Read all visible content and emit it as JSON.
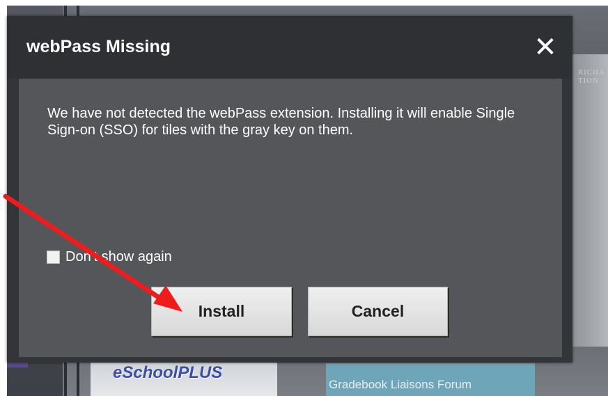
{
  "background": {
    "tiles": [
      {
        "label": "eSchoolPLUS"
      },
      {
        "label": "Gradebook Liaisons Forum"
      }
    ],
    "building_text": [
      "RICHA",
      "TION"
    ]
  },
  "dialog": {
    "title": "webPass Missing",
    "close_symbol": "✕",
    "message": "We have not detected the webPass extension. Installing it will enable Single Sign-on (SSO) for tiles with the gray key on them.",
    "checkbox_label": "Don't show again",
    "checkbox_checked": false,
    "install_label": "Install",
    "cancel_label": "Cancel"
  },
  "annotation": {
    "arrow_color": "#ee1c1c",
    "icon": "red-arrow-icon"
  },
  "colors": {
    "header_bg": "#2e3033",
    "body_bg": "#545659",
    "button_bg": "#e6e6e6"
  }
}
